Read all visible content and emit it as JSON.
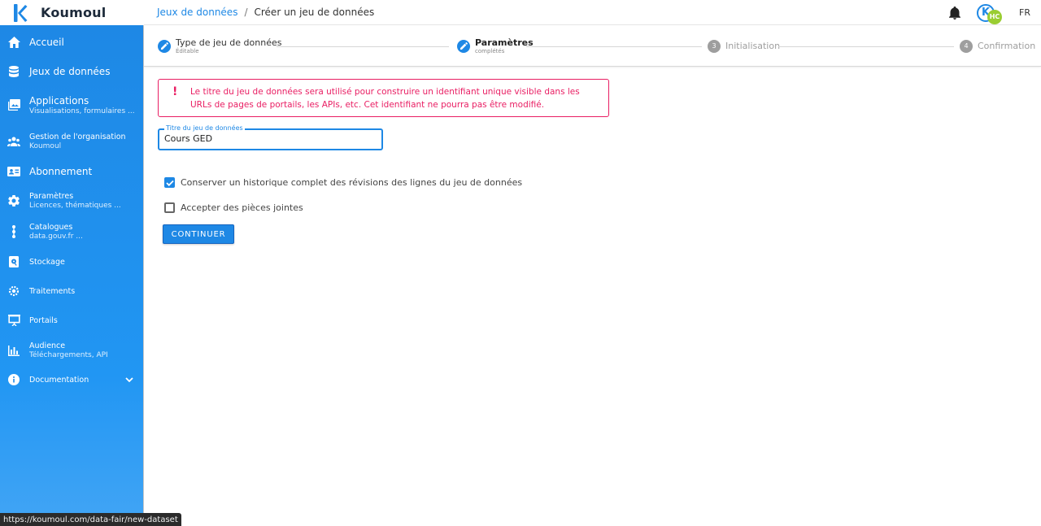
{
  "app": {
    "name": "Koumoul",
    "accent_color": "#1e88e5",
    "error_color": "#e91e63"
  },
  "breadcrumb": {
    "parent": "Jeux de données",
    "separator": "/",
    "current": "Créer un jeu de données"
  },
  "topbar": {
    "notifications_icon": "bell-icon",
    "avatar_initial": "K",
    "avatar_badge": "HC",
    "language": "FR"
  },
  "sidebar": {
    "items": [
      {
        "label": "Accueil",
        "icon": "home-icon"
      },
      {
        "label": "Jeux de données",
        "icon": "database-icon"
      },
      {
        "label": "Applications",
        "sub": "Visualisations, formulaires ...",
        "icon": "image-icon"
      },
      {
        "label": "Gestion de l'organisation",
        "sub": "Koumoul",
        "icon": "group-icon"
      },
      {
        "label": "Abonnement",
        "icon": "card-icon"
      },
      {
        "label": "Paramètres",
        "sub": "Licences, thématiques ...",
        "icon": "gear-icon"
      },
      {
        "label": "Catalogues",
        "sub": "data.gouv.fr ...",
        "icon": "transit-icon"
      },
      {
        "label": "Stockage",
        "icon": "storage-icon"
      },
      {
        "label": "Traitements",
        "icon": "cogs-icon"
      },
      {
        "label": "Portails",
        "icon": "presentation-icon"
      },
      {
        "label": "Audience",
        "sub": "Téléchargements, API",
        "icon": "chart-icon"
      },
      {
        "label": "Documentation",
        "icon": "info-icon"
      }
    ]
  },
  "stepper": {
    "steps": [
      {
        "number": "1",
        "label": "Type de jeu de données",
        "sub": "Éditable",
        "state": "done"
      },
      {
        "number": "2",
        "label": "Paramètres",
        "sub": "complétés",
        "state": "active"
      },
      {
        "number": "3",
        "label": "Initialisation",
        "state": "todo"
      },
      {
        "number": "4",
        "label": "Confirmation",
        "state": "todo"
      }
    ]
  },
  "alert": {
    "icon": "!",
    "text": "Le titre du jeu de données sera utilisé pour construire un identifiant unique visible dans les URLs de pages de portails, les APIs, etc. Cet identifiant ne pourra pas être modifié."
  },
  "form": {
    "title_field": {
      "label": "Titre du jeu de données",
      "value": "Cours GED"
    },
    "checkboxes": [
      {
        "label": "Conserver un historique complet des révisions des lignes du jeu de données",
        "checked": true
      },
      {
        "label": "Accepter des pièces jointes",
        "checked": false
      }
    ],
    "continue_label": "CONTINUER"
  },
  "status_bar": {
    "url": "https://koumoul.com/data-fair/new-dataset"
  }
}
